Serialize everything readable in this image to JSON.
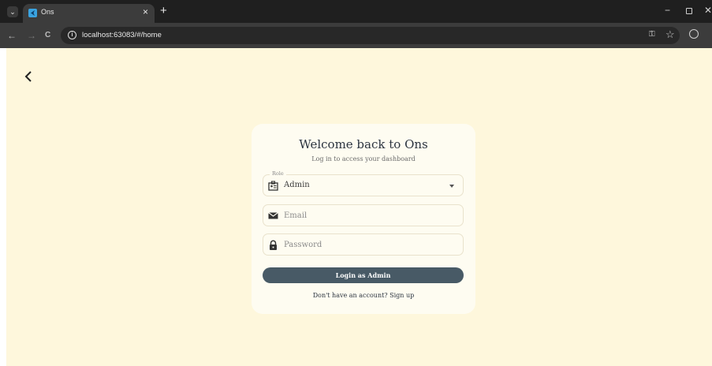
{
  "browser": {
    "tab_title": "Ons",
    "tab_close": "×",
    "new_tab": "+",
    "url": "localhost:63083/#/home",
    "window_minimize": "−",
    "window_close": "✕",
    "nav_back": "←",
    "nav_forward": "→",
    "nav_reload": "C",
    "menu": "⋮"
  },
  "login": {
    "title": "Welcome back to Ons",
    "subtitle": "Log in to access your dashboard",
    "role_label": "Role",
    "role_value": "Admin",
    "email_placeholder": "Email",
    "password_placeholder": "Password",
    "login_button": "Login as Admin",
    "signup_prompt": "Don't have an account? Sign up"
  },
  "colors": {
    "page_background": "#fef7dc",
    "card_background": "#fefcf1",
    "button_background": "#485a66",
    "title_text": "#2c3440"
  }
}
